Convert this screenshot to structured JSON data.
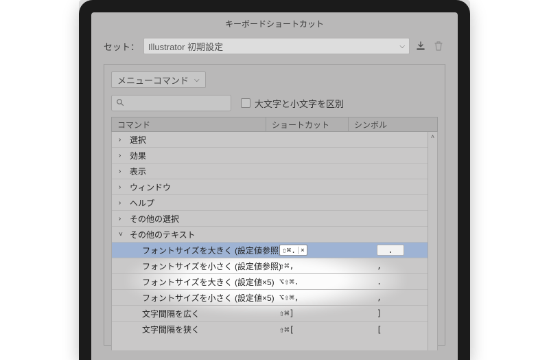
{
  "window": {
    "title": "キーボードショートカット"
  },
  "set": {
    "label": "セット：",
    "value": "Illustrator 初期設定"
  },
  "type": {
    "value": "メニューコマンド"
  },
  "search": {
    "placeholder": ""
  },
  "caseSensitive": {
    "label": "大文字と小文字を区別"
  },
  "columns": {
    "command": "コマンド",
    "shortcut": "ショートカット",
    "symbol": "シンボル"
  },
  "tree": [
    {
      "kind": "group",
      "expanded": false,
      "label": "選択"
    },
    {
      "kind": "group",
      "expanded": false,
      "label": "効果"
    },
    {
      "kind": "group",
      "expanded": false,
      "label": "表示"
    },
    {
      "kind": "group",
      "expanded": false,
      "label": "ウィンドウ"
    },
    {
      "kind": "group",
      "expanded": false,
      "label": "ヘルプ"
    },
    {
      "kind": "group",
      "expanded": false,
      "label": "その他の選択"
    },
    {
      "kind": "group",
      "expanded": true,
      "label": "その他のテキスト"
    },
    {
      "kind": "item",
      "selected": true,
      "label": "フォントサイズを大きく (設定値参照)",
      "shortcut": "⇧⌘.",
      "symbol": ".",
      "editing": true
    },
    {
      "kind": "item",
      "label": "フォントサイズを小さく (設定値参照)",
      "shortcut": "⇧⌘,",
      "symbol": ","
    },
    {
      "kind": "item",
      "label": "フォントサイズを大きく (設定値×5)",
      "shortcut": "⌥⇧⌘.",
      "symbol": "."
    },
    {
      "kind": "item",
      "label": "フォントサイズを小さく (設定値×5)",
      "shortcut": "⌥⇧⌘,",
      "symbol": ","
    },
    {
      "kind": "item",
      "label": "文字間隔を広く",
      "shortcut": "⇧⌘]",
      "symbol": "]"
    },
    {
      "kind": "item",
      "label": "文字間隔を狭く",
      "shortcut": "⇧⌘[",
      "symbol": "["
    }
  ]
}
